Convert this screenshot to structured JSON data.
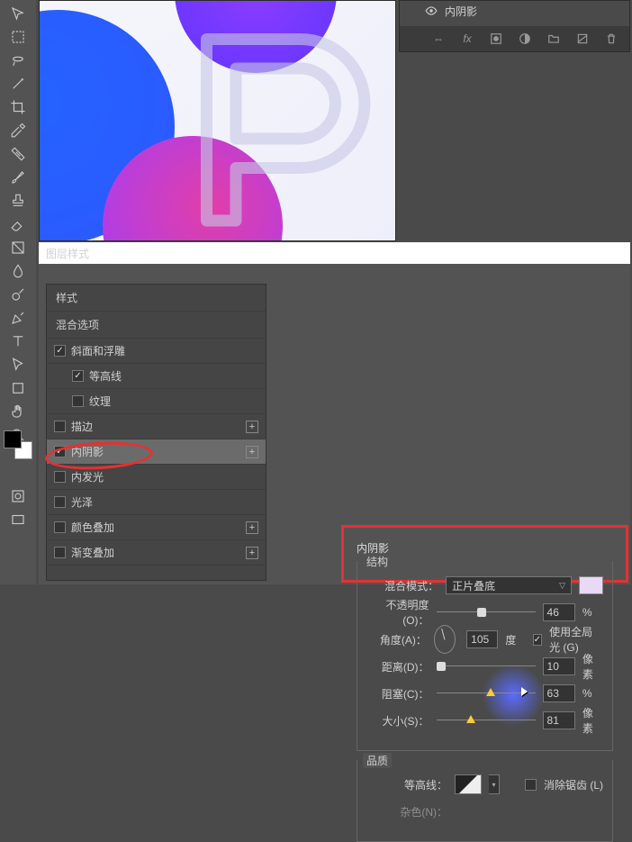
{
  "miniPanel": {
    "effectName": "内阴影",
    "icons": [
      "link",
      "fx",
      "mask",
      "adjust",
      "group",
      "new",
      "trash"
    ]
  },
  "dialog": {
    "title": "图层样式"
  },
  "stylesList": {
    "head1": "样式",
    "head2": "混合选项",
    "items": [
      {
        "label": "斜面和浮雕",
        "checked": true,
        "hasPlus": false,
        "sub": false
      },
      {
        "label": "等高线",
        "checked": true,
        "hasPlus": false,
        "sub": true
      },
      {
        "label": "纹理",
        "checked": false,
        "hasPlus": false,
        "sub": true
      },
      {
        "label": "描边",
        "checked": false,
        "hasPlus": true,
        "sub": false
      },
      {
        "label": "内阴影",
        "checked": true,
        "hasPlus": true,
        "sub": false,
        "selected": true
      },
      {
        "label": "内发光",
        "checked": false,
        "hasPlus": false,
        "sub": false
      },
      {
        "label": "光泽",
        "checked": false,
        "hasPlus": false,
        "sub": false
      },
      {
        "label": "颜色叠加",
        "checked": false,
        "hasPlus": true,
        "sub": false
      },
      {
        "label": "渐变叠加",
        "checked": false,
        "hasPlus": true,
        "sub": false
      }
    ]
  },
  "settings": {
    "title": "内阴影",
    "structLabel": "结构",
    "blendModeLabel": "混合模式：",
    "blendModeValue": "正片叠底",
    "colorSwatch": "#e9d9f6",
    "opacityLabel": "不透明度(O)：",
    "opacityValue": "46",
    "opacityUnit": "%",
    "opacityPct": 46,
    "angleLabel": "角度(A)：",
    "angleValue": "105",
    "angleUnit": "度",
    "globalLightLabel": "使用全局光 (G)",
    "globalLightChecked": true,
    "distanceLabel": "距离(D)：",
    "distanceValue": "10",
    "distanceUnit": "像素",
    "distancePct": 5,
    "chokeLabel": "阻塞(C)：",
    "chokeValue": "63",
    "chokeUnit": "%",
    "chokePct": 55,
    "sizeLabel": "大小(S)：",
    "sizeValue": "81",
    "sizeUnit": "像素",
    "sizePct": 35,
    "qualityLabel": "品质",
    "contourLabel": "等高线：",
    "antiAliasLabel": "消除锯齿 (L)",
    "antiAliasChecked": false,
    "noiseLabel": "杂色(N)："
  }
}
